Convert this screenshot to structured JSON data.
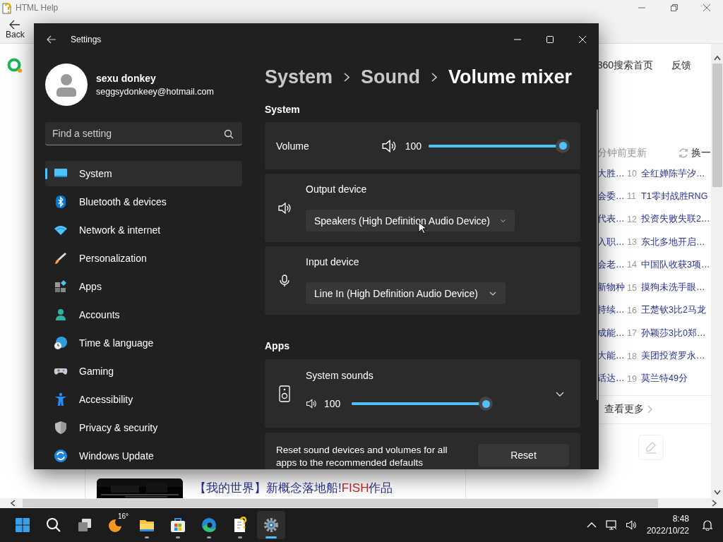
{
  "help_window": {
    "title": "HTML Help",
    "back_label": "Back"
  },
  "browser": {
    "top_links": [
      "360搜索首页",
      "反馈"
    ],
    "hot_list": {
      "updated": "分钟前更新",
      "refresh": "换一",
      "rows": [
        {
          "left": "大胜…",
          "rank": "10",
          "title": "全红婵陈芋汐…"
        },
        {
          "left": "会委…",
          "rank": "11",
          "title": "T1零封战胜RNG"
        },
        {
          "left": "代表…",
          "rank": "12",
          "title": "投资失败失联2…"
        },
        {
          "left": "入职…",
          "rank": "13",
          "title": "东北多地开启…"
        },
        {
          "left": "会老…",
          "rank": "14",
          "title": "中国队收获3项…"
        },
        {
          "left": "新物种",
          "rank": "15",
          "title": "摸狗未洗手眼…"
        },
        {
          "left": "持续…",
          "rank": "16",
          "title": "王楚钦3比2马龙"
        },
        {
          "left": "成能…",
          "rank": "17",
          "title": "孙颖莎3比0郑…"
        },
        {
          "left": "大能…",
          "rank": "18",
          "title": "美团投资罗永…"
        },
        {
          "left": "话达…",
          "rank": "19",
          "title": "莫兰特49分"
        }
      ]
    },
    "more": "查看更多",
    "video": {
      "title_parts": [
        {
          "text": "【我的世界】新概念落地船!",
          "highlight": false
        },
        {
          "text": "FISH",
          "highlight": true
        },
        {
          "text": "作品",
          "highlight": false
        }
      ]
    }
  },
  "settings": {
    "title": "Settings",
    "user": {
      "name": "sexu donkey",
      "email": "seggsydonkeey@hotmail.com"
    },
    "search": {
      "placeholder": "Find a setting"
    },
    "nav": [
      {
        "label": "System",
        "kind": "system",
        "selected": true
      },
      {
        "label": "Bluetooth & devices",
        "kind": "bluetooth",
        "selected": false
      },
      {
        "label": "Network & internet",
        "kind": "network",
        "selected": false
      },
      {
        "label": "Personalization",
        "kind": "personalization",
        "selected": false
      },
      {
        "label": "Apps",
        "kind": "apps",
        "selected": false
      },
      {
        "label": "Accounts",
        "kind": "accounts",
        "selected": false
      },
      {
        "label": "Time & language",
        "kind": "time",
        "selected": false
      },
      {
        "label": "Gaming",
        "kind": "gaming",
        "selected": false
      },
      {
        "label": "Accessibility",
        "kind": "accessibility",
        "selected": false
      },
      {
        "label": "Privacy & security",
        "kind": "privacy",
        "selected": false
      },
      {
        "label": "Windows Update",
        "kind": "update",
        "selected": false
      }
    ],
    "breadcrumb": [
      "System",
      "Sound",
      "Volume mixer"
    ],
    "system_section": {
      "heading": "System",
      "volume": {
        "label": "Volume",
        "value": "100",
        "level": 1
      },
      "output": {
        "label": "Output device",
        "device": "Speakers (High Definition Audio Device)"
      },
      "input": {
        "label": "Input device",
        "device": "Line In (High Definition Audio Device)"
      }
    },
    "apps_section": {
      "heading": "Apps",
      "apps": [
        {
          "name": "System sounds",
          "value": "100",
          "level": 1,
          "expanded": false
        }
      ]
    },
    "reset": {
      "text": "Reset sound devices and volumes for all apps to the recommended defaults",
      "button": "Reset"
    }
  },
  "taskbar": {
    "items": [
      {
        "kind": "start",
        "running": false,
        "selected": false
      },
      {
        "kind": "search",
        "running": false,
        "selected": false
      },
      {
        "kind": "taskview",
        "running": false,
        "selected": false
      },
      {
        "kind": "weather",
        "text": "16°",
        "running": false,
        "selected": false
      },
      {
        "kind": "explorer",
        "running": true,
        "selected": false
      },
      {
        "kind": "store",
        "running": true,
        "selected": false
      },
      {
        "kind": "edge",
        "running": true,
        "selected": false
      },
      {
        "kind": "help",
        "running": true,
        "selected": false
      },
      {
        "kind": "settings",
        "running": true,
        "selected": true
      }
    ],
    "time": "8:48",
    "date": "2022/10/22"
  }
}
